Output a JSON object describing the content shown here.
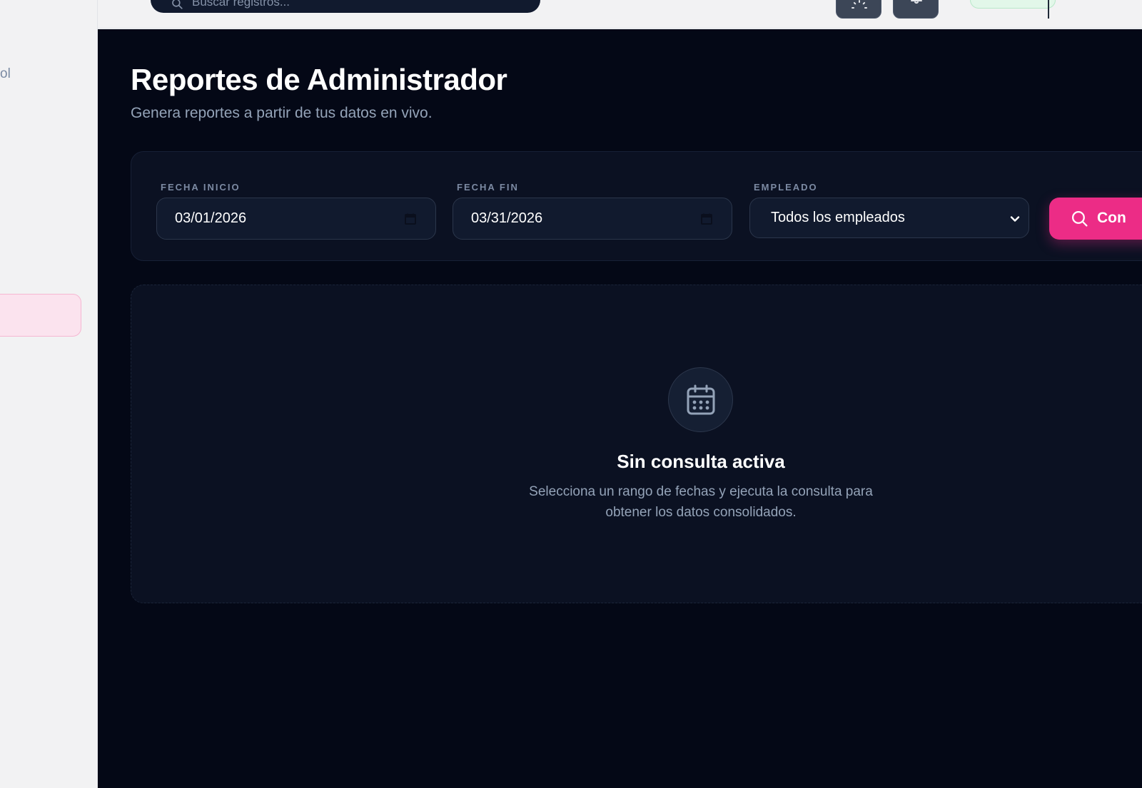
{
  "sidebar": {
    "partial_label": "ol"
  },
  "topbar": {
    "search_placeholder": "Buscar registros..."
  },
  "main": {
    "title": "Reportes de Administrador",
    "subtitle": "Genera reportes a partir de tus datos en vivo."
  },
  "filters": {
    "start_label": "FECHA INICIO",
    "start_value": "03/01/2026",
    "end_label": "FECHA FIN",
    "end_value": "03/31/2026",
    "employee_label": "EMPLEADO",
    "employee_value": "Todos los empleados",
    "query_button": "Con"
  },
  "empty_state": {
    "title": "Sin consulta activa",
    "desc_line1": "Selecciona un rango de fechas y ejecuta la consulta para",
    "desc_line2": "obtener los datos consolidados."
  },
  "colors": {
    "accent": "#ec2c86",
    "background": "#040816",
    "card": "#0b1122",
    "sidebar": "#f2f2f3"
  },
  "icons": [
    "search-icon",
    "theme-icon",
    "notification-icon",
    "calendar-icon",
    "chevron-down-icon"
  ]
}
